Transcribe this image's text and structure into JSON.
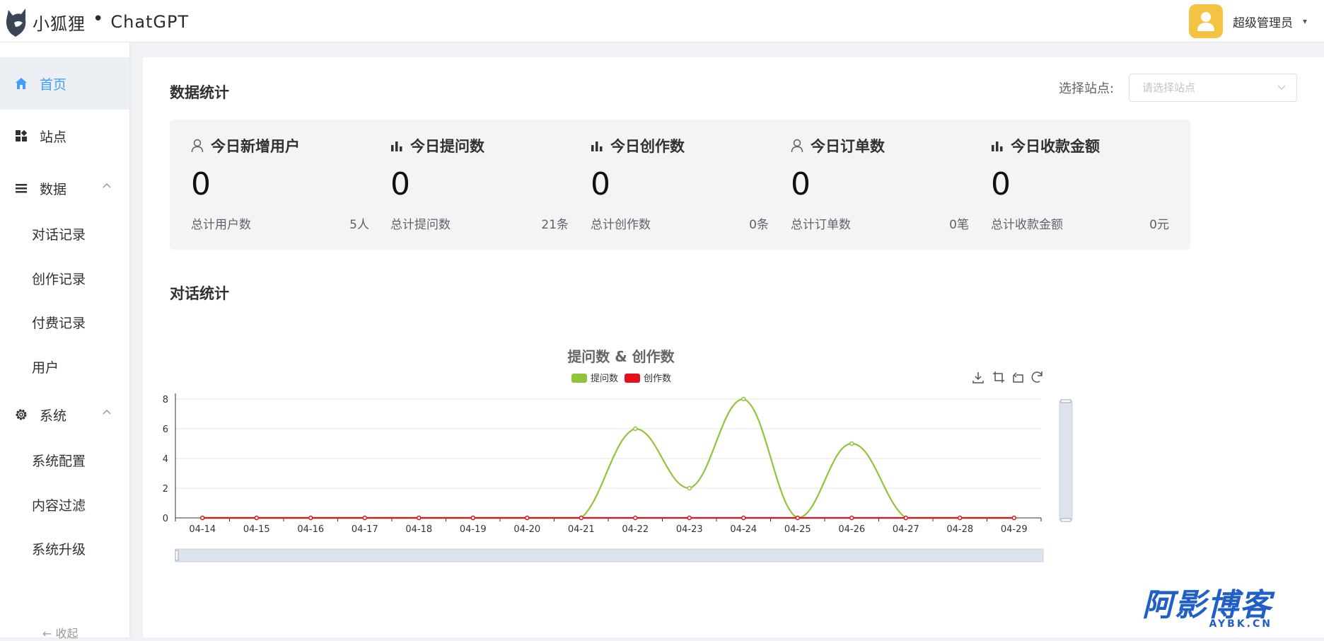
{
  "app": {
    "logo_text": "小狐狸",
    "logo_dot": "•",
    "logo_product": "ChatGPT"
  },
  "user": {
    "name": "超级管理员",
    "caret": "▾"
  },
  "sidebar": {
    "items": [
      {
        "label": "首页",
        "icon": "home-icon",
        "active": true
      },
      {
        "label": "站点",
        "icon": "grid-icon"
      },
      {
        "label": "数据",
        "icon": "list-icon",
        "expanded": true,
        "children": [
          "对话记录",
          "创作记录",
          "付费记录",
          "用户"
        ]
      },
      {
        "label": "系统",
        "icon": "gear-icon",
        "expanded": true,
        "children": [
          "系统配置",
          "内容过滤",
          "系统升级"
        ]
      }
    ],
    "collapse_label": "← 收起"
  },
  "stats": {
    "title": "数据统计",
    "station_label": "选择站点:",
    "station_placeholder": "请选择站点",
    "cards": [
      {
        "title": "今日新增用户",
        "icon": "user-icon",
        "value": "0",
        "foot_label": "总计用户数",
        "foot_value": "5人"
      },
      {
        "title": "今日提问数",
        "icon": "bar-chart-icon",
        "value": "0",
        "foot_label": "总计提问数",
        "foot_value": "21条"
      },
      {
        "title": "今日创作数",
        "icon": "bar-chart-icon",
        "value": "0",
        "foot_label": "总计创作数",
        "foot_value": "0条"
      },
      {
        "title": "今日订单数",
        "icon": "user-icon",
        "value": "0",
        "foot_label": "总计订单数",
        "foot_value": "0笔"
      },
      {
        "title": "今日收款金额",
        "icon": "bar-chart-icon",
        "value": "0",
        "foot_label": "总计收款金额",
        "foot_value": "0元"
      }
    ]
  },
  "conversation": {
    "title": "对话统计"
  },
  "chart_data": {
    "type": "line",
    "title": "提问数 & 创作数",
    "categories": [
      "04-14",
      "04-15",
      "04-16",
      "04-17",
      "04-18",
      "04-19",
      "04-20",
      "04-21",
      "04-22",
      "04-23",
      "04-24",
      "04-25",
      "04-26",
      "04-27",
      "04-28",
      "04-29"
    ],
    "series": [
      {
        "name": "提问数",
        "color": "#91c43a",
        "values": [
          0,
          0,
          0,
          0,
          0,
          0,
          0,
          0,
          6,
          2,
          8,
          0,
          5,
          0,
          0,
          0
        ]
      },
      {
        "name": "创作数",
        "color": "#e3111c",
        "values": [
          0,
          0,
          0,
          0,
          0,
          0,
          0,
          0,
          0,
          0,
          0,
          0,
          0,
          0,
          0,
          0
        ]
      }
    ],
    "ylim": [
      0,
      8
    ],
    "yticks": [
      0,
      2,
      4,
      6,
      8
    ],
    "legend": "top-center",
    "grid": true,
    "smooth": true,
    "toolbox": [
      "download-icon",
      "crop-icon",
      "crop-back-icon",
      "refresh-icon"
    ]
  },
  "watermark": {
    "big": "阿影博客",
    "small": "AYBK.CN"
  }
}
